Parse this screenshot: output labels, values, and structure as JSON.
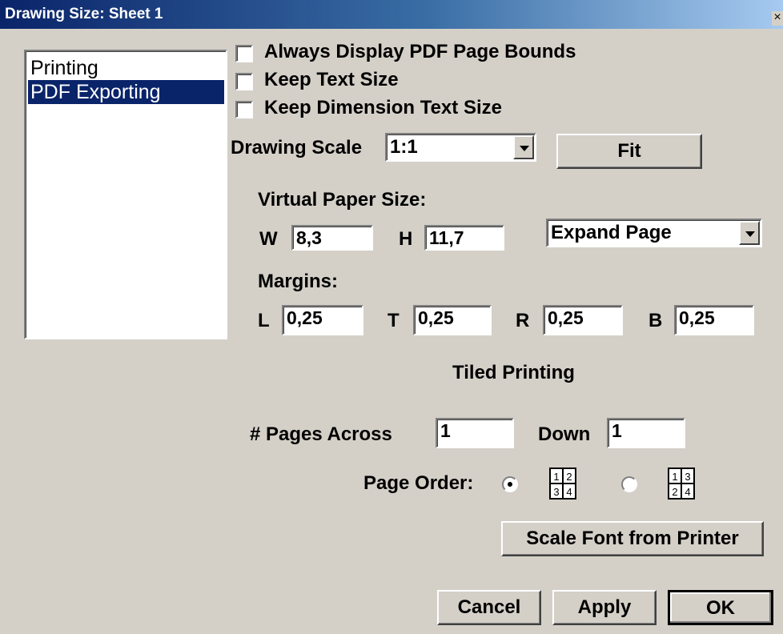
{
  "window": {
    "title": "Drawing Size: Sheet 1",
    "close_glyph": "×"
  },
  "sidebar": {
    "items": [
      {
        "label": "Printing",
        "selected": false
      },
      {
        "label": "PDF Exporting",
        "selected": true
      }
    ]
  },
  "options": {
    "always_display_bounds": {
      "label": "Always Display PDF Page Bounds",
      "checked": false
    },
    "keep_text_size": {
      "label": "Keep Text Size",
      "checked": false
    },
    "keep_dim_text_size": {
      "label": "Keep Dimension Text Size",
      "checked": false
    }
  },
  "scale": {
    "label": "Drawing Scale",
    "value": "1:1",
    "fit_label": "Fit"
  },
  "paper": {
    "heading": "Virtual Paper Size:",
    "w_label": "W",
    "w_value": "8,3",
    "h_label": "H",
    "h_value": "11,7",
    "mode_value": "Expand Page"
  },
  "margins": {
    "heading": "Margins:",
    "l_label": "L",
    "l_value": "0,25",
    "t_label": "T",
    "t_value": "0,25",
    "r_label": "R",
    "r_value": "0,25",
    "b_label": "B",
    "b_value": "0,25"
  },
  "tiled": {
    "heading": "Tiled Printing",
    "across_label": "# Pages Across",
    "across_value": "1",
    "down_label": "Down",
    "down_value": "1",
    "order_label": "Page Order:",
    "order_a_digits": [
      "1",
      "2",
      "3",
      "4"
    ],
    "order_b_digits": [
      "1",
      "3",
      "2",
      "4"
    ],
    "selected_order": "a"
  },
  "buttons": {
    "scale_font": "Scale Font from Printer",
    "cancel": "Cancel",
    "apply": "Apply",
    "ok": "OK"
  }
}
